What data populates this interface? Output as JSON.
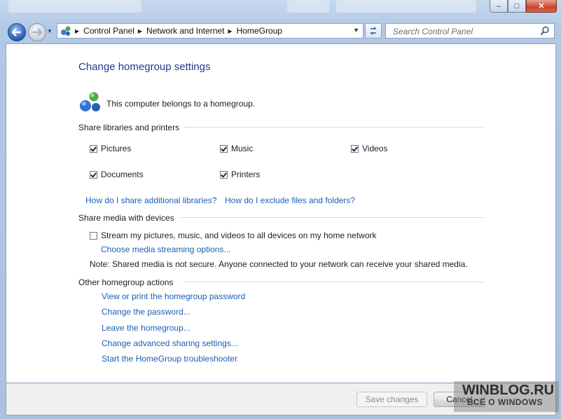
{
  "colors": {
    "link": "#1a5fb4",
    "title": "#1f3c88",
    "frame": "#b2c9e4"
  },
  "window": {
    "min_glyph": "–",
    "max_glyph": "□",
    "close_glyph": "✕"
  },
  "nav": {
    "back_icon": "arrow-left-icon",
    "breadcrumb": [
      "Control Panel",
      "Network and Internet",
      "HomeGroup"
    ],
    "search_placeholder": "Search Control Panel"
  },
  "page": {
    "title": "Change homegroup settings",
    "status": "This computer belongs to a homegroup.",
    "share_section": "Share libraries and printers",
    "libraries": [
      {
        "label": "Pictures",
        "checked": true
      },
      {
        "label": "Music",
        "checked": true
      },
      {
        "label": "Videos",
        "checked": true
      },
      {
        "label": "Documents",
        "checked": true
      },
      {
        "label": "Printers",
        "checked": true
      }
    ],
    "share_links": [
      "How do I share additional libraries?",
      "How do I exclude files and folders?"
    ],
    "media_section": "Share media with devices",
    "stream_label": "Stream my pictures, music, and videos to all devices on my home network",
    "stream_checked": false,
    "media_link": "Choose media streaming options...",
    "note": "Note: Shared media is not secure. Anyone connected to your network can receive your shared media.",
    "actions_section": "Other homegroup actions",
    "actions": [
      "View or print the homegroup password",
      "Change the password...",
      "Leave the homegroup...",
      "Change advanced sharing settings...",
      "Start the HomeGroup troubleshooter"
    ]
  },
  "footer": {
    "save": "Save changes",
    "cancel": "Cancel"
  },
  "watermark": {
    "line1": "WINBLOG.RU",
    "line2": "ВСЁ О WINDOWS"
  }
}
